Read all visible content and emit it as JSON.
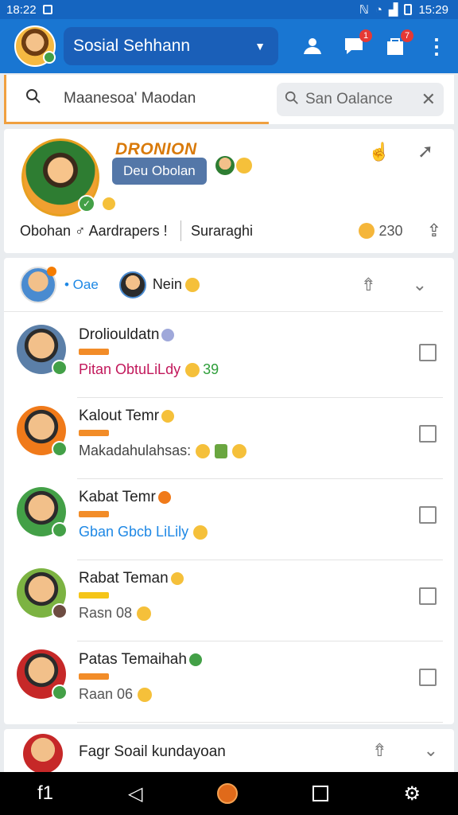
{
  "status": {
    "time_left": "18:22",
    "time_right": "15:29"
  },
  "appbar": {
    "account_name": "Sosial Sehhann",
    "badges": {
      "messages": "1",
      "notifications": "7"
    }
  },
  "search": {
    "left_text": "Maanesoa' Maodan",
    "right_placeholder": "San Oalance"
  },
  "profile": {
    "title": "DRONION",
    "pill_label": "Deu Obolan",
    "stat_left": "Obohan ♂ Aardrapers !",
    "stat_mid": "Suraraghi",
    "coins": "230"
  },
  "list_header": {
    "dot_label": "• Oae",
    "name": "Nein"
  },
  "rows": [
    {
      "name": "Droliouldatn",
      "subtitle": "Pitan ObtuLiLdy",
      "sub_extra": "39",
      "name_icon_color": "#9fa8da",
      "bar_color": "#f28c28",
      "sub_color": "#c2185b",
      "status_color": "#43a047",
      "avatar_bg": "#5b7fa8"
    },
    {
      "name": "Kalout Temr",
      "subtitle": "Makadahulahsas:",
      "sub_extra": "",
      "name_icon_color": "#f5c03a",
      "bar_color": "#f28c28",
      "sub_color": "#444444",
      "status_color": "#43a047",
      "avatar_bg": "#f07a1a"
    },
    {
      "name": "Kabat Temr",
      "subtitle": "Gban Gbcb LiLily",
      "sub_extra": "",
      "name_icon_color": "#f07a1a",
      "bar_color": "#f28c28",
      "sub_color": "#1e88e5",
      "status_color": "#43a047",
      "avatar_bg": "#43a047"
    },
    {
      "name": "Rabat Teman",
      "subtitle": "Rasn 08",
      "sub_extra": "",
      "name_icon_color": "#f5c03a",
      "bar_color": "#f5c518",
      "sub_color": "#555555",
      "status_color": "#6d4c41",
      "avatar_bg": "#7cb342"
    },
    {
      "name": "Patas Temaihah",
      "subtitle": "Raan 06",
      "sub_extra": "",
      "name_icon_color": "#43a047",
      "bar_color": "#f28c28",
      "sub_color": "#555555",
      "status_color": "#43a047",
      "avatar_bg": "#c62828"
    }
  ],
  "bottom_card": {
    "name": "Fagr Soail kundayoan"
  },
  "icons": [
    "search-icon",
    "clear-icon",
    "people-icon",
    "chat-icon",
    "bag-icon",
    "more-icon",
    "share-icon",
    "back-icon",
    "home-icon",
    "recents-icon"
  ]
}
